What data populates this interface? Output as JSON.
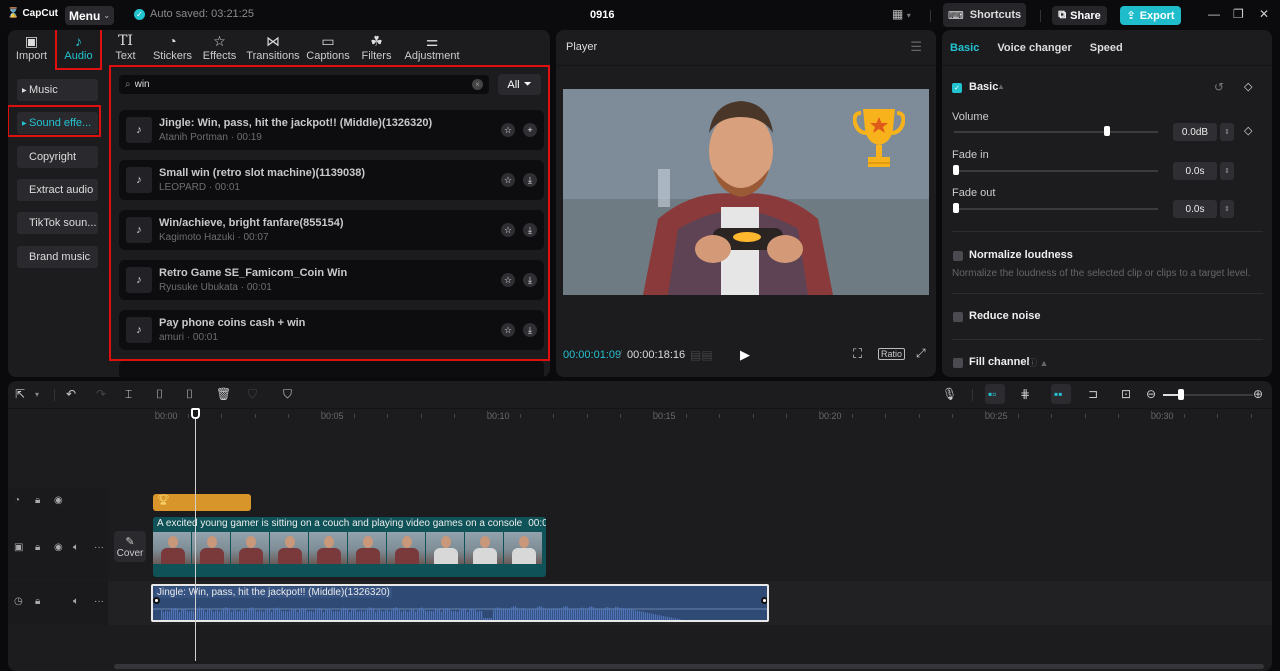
{
  "app": {
    "logo": "CapCut",
    "menu_label": "Menu",
    "autosave": "Auto saved: 03:21:25",
    "project_title": "0916",
    "shortcuts_label": "Shortcuts",
    "share_label": "Share",
    "export_label": "Export",
    "accent_color": "#22c3d0"
  },
  "toolbar_tabs": [
    {
      "label": "Import",
      "icon": "import-icon"
    },
    {
      "label": "Audio",
      "icon": "audio-icon",
      "active": true
    },
    {
      "label": "Text",
      "icon": "text-icon"
    },
    {
      "label": "Stickers",
      "icon": "stickers-icon"
    },
    {
      "label": "Effects",
      "icon": "effects-icon"
    },
    {
      "label": "Transitions",
      "icon": "transitions-icon"
    },
    {
      "label": "Captions",
      "icon": "captions-icon"
    },
    {
      "label": "Filters",
      "icon": "filters-icon"
    },
    {
      "label": "Adjustment",
      "icon": "adjustment-icon"
    }
  ],
  "audio_nav": [
    {
      "label": "Music",
      "expandable": true
    },
    {
      "label": "Sound effe...",
      "expandable": true,
      "selected": true
    },
    {
      "label": "Copyright"
    },
    {
      "label": "Extract audio"
    },
    {
      "label": "TikTok soun..."
    },
    {
      "label": "Brand music"
    }
  ],
  "search": {
    "value": "win",
    "placeholder": "Search"
  },
  "filter": {
    "label": "All"
  },
  "sounds": [
    {
      "title": "Jingle: Win, pass, hit the jackpot!! (Middle)(1326320)",
      "author": "Atanih Portman",
      "duration": "00:19",
      "action": "add"
    },
    {
      "title": "Small win (retro slot machine)(1139038)",
      "author": "LEOPARD",
      "duration": "00:01",
      "action": "download"
    },
    {
      "title": "Win/achieve, bright fanfare(855154)",
      "author": "Kagimoto Hazuki",
      "duration": "00:07",
      "action": "download"
    },
    {
      "title": "Retro Game SE_Famicom_Coin Win",
      "author": "Ryusuke Ubukata",
      "duration": "00:01",
      "action": "download"
    },
    {
      "title": "Pay phone coins cash + win",
      "author": "amuri",
      "duration": "00:01",
      "action": "download"
    }
  ],
  "player": {
    "title": "Player",
    "current_time": "00:00:01:09",
    "separator": "/",
    "total_time": "00:00:18:16",
    "ratio_label": "Ratio"
  },
  "properties": {
    "tabs": [
      "Basic",
      "Voice changer",
      "Speed"
    ],
    "active_tab": "Basic",
    "basic_section": {
      "label": "Basic",
      "checked": true
    },
    "volume": {
      "label": "Volume",
      "value": "0.0dB",
      "slider_fraction": 0.75
    },
    "fade_in": {
      "label": "Fade in",
      "value": "0.0s",
      "slider_fraction": 0
    },
    "fade_out": {
      "label": "Fade out",
      "value": "0.0s",
      "slider_fraction": 0
    },
    "normalize": {
      "label": "Normalize loudness",
      "desc": "Normalize the loudness of the selected clip or clips to a target level.",
      "checked": false
    },
    "reduce_noise": {
      "label": "Reduce noise",
      "checked": false
    },
    "fill_channel": {
      "label": "Fill channel",
      "checked": false
    }
  },
  "timeline": {
    "ruler_labels": [
      "00:00",
      "00:05",
      "00:10",
      "00:15",
      "00:20",
      "00:25",
      "00:30"
    ],
    "cover_label": "Cover",
    "video_clip": {
      "caption": "A excited young gamer is sitting on a couch and playing video games on a console",
      "time": "00:0"
    },
    "audio_clip": {
      "title": "Jingle: Win, pass, hit the jackpot!! (Middle)(1326320)"
    },
    "zoom_fraction": 0.2
  }
}
